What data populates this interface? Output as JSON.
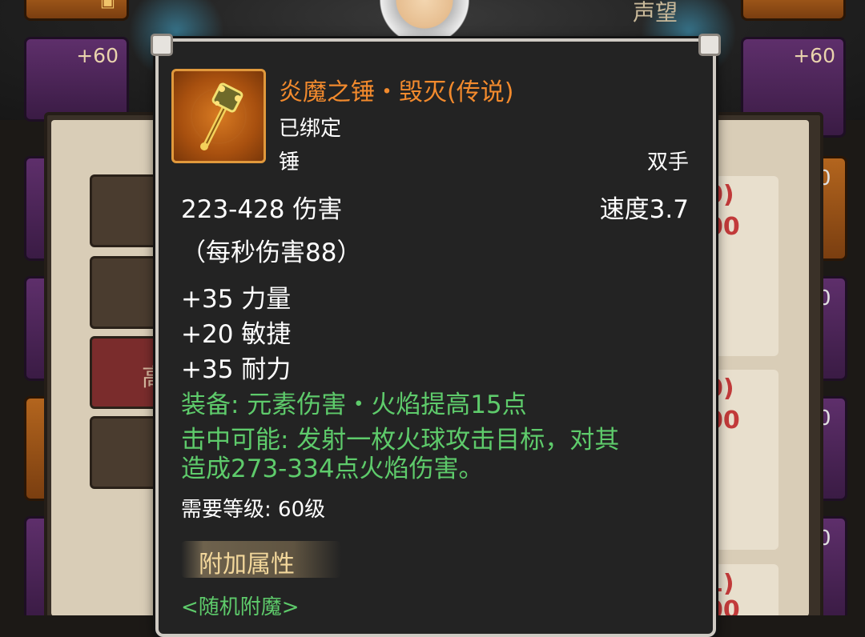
{
  "background": {
    "slot_plus_left": "+60",
    "slot_plus_right": "+60",
    "top_right_label": "声望",
    "partial_left_glyph": "高",
    "red_stats": [
      "0)",
      "00",
      "0)",
      "00",
      "1)",
      "00"
    ],
    "white_stats": [
      "0",
      "0",
      "0",
      "0"
    ]
  },
  "tooltip": {
    "item_name": "炎魔之锤・毁灭(传说)",
    "binding": "已绑定",
    "weapon_type": "锤",
    "handedness": "双手",
    "damage": "223-428 伤害",
    "speed": "速度3.7",
    "dps": "（每秒伤害88）",
    "stats": [
      "+35 力量",
      "+20 敏捷",
      "+35 耐力"
    ],
    "equip_effect": "装备: 元素伤害・火焰提高15点",
    "proc_effect_line1": "击中可能: 发射一枚火球攻击目标，对其",
    "proc_effect_line2": "造成273-334点火焰伤害。",
    "requirement": "需要等级: 60级",
    "extra_attributes_header": "附加属性",
    "random_enchant": "<随机附魔>"
  },
  "colors": {
    "legendary": "#f28a2d",
    "effect_green": "#5ecb6b",
    "header_gold": "#f2d79b",
    "tooltip_bg": "#232323"
  },
  "icons": {
    "item": "fire-hammer-icon",
    "lock": "lock-icon"
  }
}
